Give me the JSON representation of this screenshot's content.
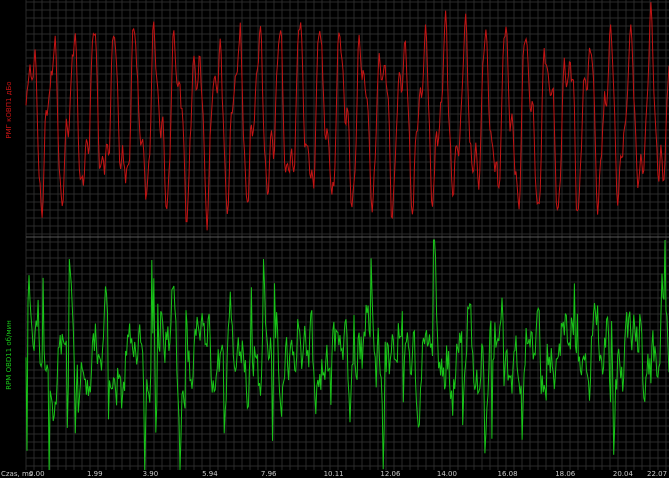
{
  "chart_data": {
    "type": "line",
    "panels": [
      {
        "id": "top",
        "ylabel": "РМГ кОВП1 дБо",
        "color": "#c41414",
        "seed": 17,
        "samples": 640,
        "periods": [
          20.5,
          9.7,
          5.1
        ],
        "amps": [
          1.0,
          0.45,
          0.25
        ],
        "noise": 0.18,
        "ylim": [
          -1.6,
          1.6
        ]
      },
      {
        "id": "bottom",
        "ylabel": "RPM OBD11 об/мин",
        "color": "#19c419",
        "seed": 91,
        "samples": 640,
        "periods": [
          33.0,
          11.3,
          6.8
        ],
        "amps": [
          0.35,
          0.25,
          0.2
        ],
        "noise": 0.55,
        "spikes": 0.06,
        "ylim": [
          -1.6,
          1.6
        ]
      }
    ],
    "x_axis": {
      "label": "Czas, ms",
      "ticks": [
        "0.00",
        "1.99",
        "3.90",
        "5.94",
        "7.96",
        "10.11",
        "12.06",
        "14.00",
        "16.08",
        "18.06",
        "20.04",
        "22.07"
      ],
      "range": [
        0,
        22.07
      ]
    },
    "grid": true,
    "background": "#000000",
    "grid_color": "#2a2a2a"
  }
}
